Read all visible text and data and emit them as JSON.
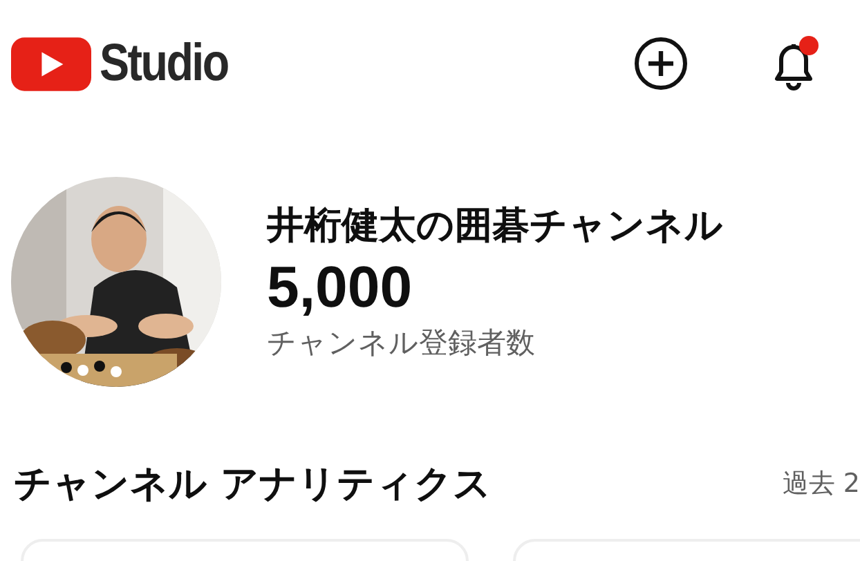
{
  "header": {
    "logo_text": "Studio",
    "notifications": {
      "unread": true
    }
  },
  "channel": {
    "name": "井桁健太の囲碁チャンネル",
    "subscribers": "5,000",
    "subscribers_label": "チャンネル登録者数"
  },
  "analytics": {
    "title": "チャンネル アナリティクス",
    "period": "過去 2"
  }
}
